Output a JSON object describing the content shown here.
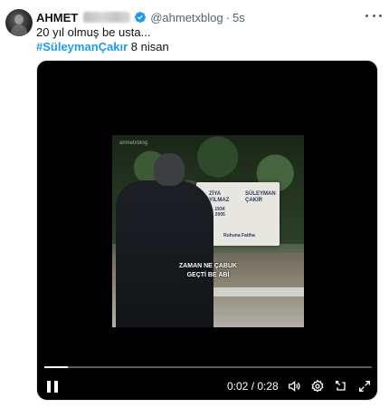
{
  "tweet": {
    "author_name": "AHMET",
    "handle": "@ahmetxblog",
    "separator": "·",
    "time": "5s",
    "text_line1": "20 yıl olmuş be usta...",
    "hashtag": "#SüleymanÇakır",
    "date_text": " 8 nisan",
    "accent_color": "#1d9bf0",
    "icons": [
      "verified-badge-icon",
      "more-options-icon"
    ]
  },
  "video": {
    "watermark": "ahmetxblog",
    "gravestone": {
      "name_left": "ZİYA\nYILMAZ",
      "dates_left": "D. 1934\nÖ. 2005",
      "name_right": "SÜLEYMAN\nÇAKIR",
      "footer": "Ruhuna Fatiha"
    },
    "caption_line1": "ZAMAN NE ÇABUK",
    "caption_line2": "GEÇTİ BE ABİ",
    "progress_fraction": 0.071,
    "time_current": "0:02",
    "time_separator": " / ",
    "time_total": "0:28",
    "controls": [
      "pause-icon",
      "volume-icon",
      "settings-icon",
      "exit-fullscreen-icon",
      "fullscreen-icon"
    ]
  }
}
